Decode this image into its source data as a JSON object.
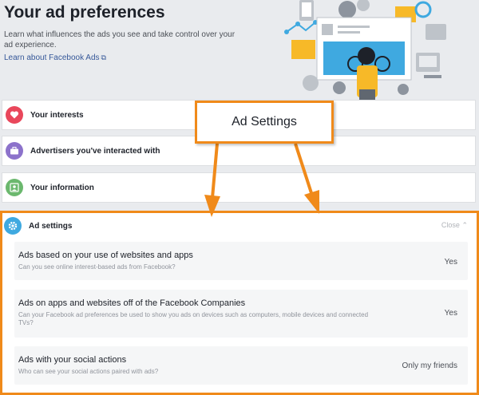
{
  "header": {
    "title": "Your ad preferences",
    "description": "Learn what influences the ads you see and take control over your ad experience.",
    "learn_link": "Learn about Facebook Ads",
    "learn_link_icon": "external-link-icon"
  },
  "sections": [
    {
      "label": "Your interests",
      "icon": "heart-icon",
      "color": "#e9475b"
    },
    {
      "label": "Advertisers you've interacted with",
      "icon": "briefcase-icon",
      "color": "#8c72cb"
    },
    {
      "label": "Your information",
      "icon": "person-card-icon",
      "color": "#6bb86e"
    }
  ],
  "ad_settings": {
    "label": "Ad settings",
    "icon": "gear-icon",
    "color": "#3fa9e0",
    "close_label": "Close",
    "rows": [
      {
        "title": "Ads based on your use of websites and apps",
        "subtitle": "Can you see online interest-based ads from Facebook?",
        "value": "Yes"
      },
      {
        "title": "Ads on apps and websites off of the Facebook Companies",
        "subtitle": "Can your Facebook ad preferences be used to show you ads on devices such as computers, mobile devices and connected TVs?",
        "value": "Yes"
      },
      {
        "title": "Ads with your social actions",
        "subtitle": "Who can see your social actions paired with ads?",
        "value": "Only my friends"
      }
    ]
  },
  "annotation": {
    "label": "Ad Settings",
    "accent": "#f08a1a"
  }
}
